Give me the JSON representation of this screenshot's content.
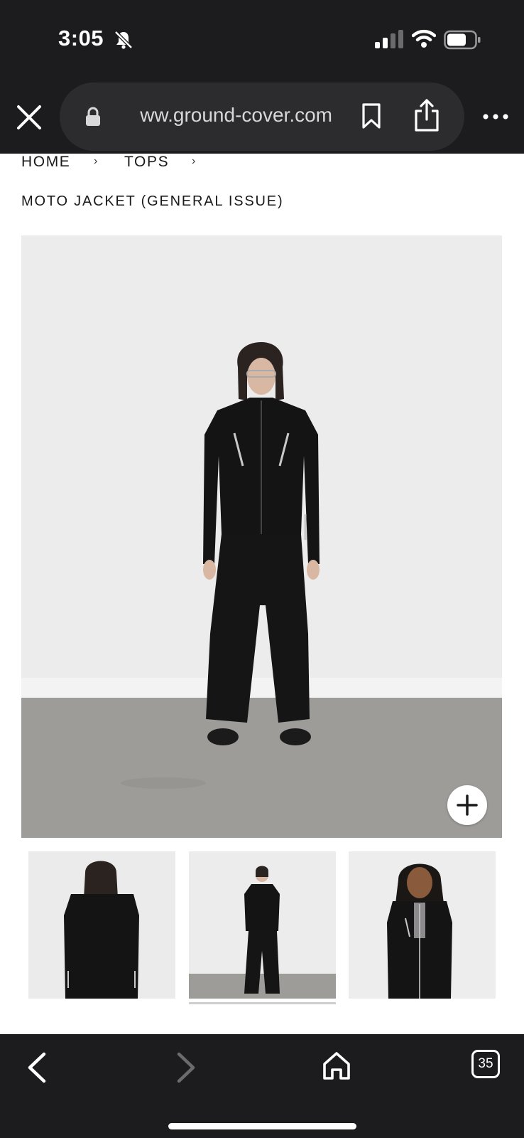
{
  "status_bar": {
    "time": "3:05"
  },
  "browser": {
    "url": "ww.ground-cover.com",
    "tab_count": "35"
  },
  "breadcrumb": {
    "items": [
      "HOME",
      "TOPS"
    ],
    "separator": "›"
  },
  "product": {
    "title": "MOTO JACKET (GENERAL ISSUE)"
  },
  "gallery": {
    "thumbnail_count": 3,
    "selected_thumbnail": 2
  },
  "icons": {
    "bell": "bell-slash-icon",
    "signal": "cellular-signal-icon",
    "wifi": "wifi-icon",
    "battery": "battery-icon",
    "close": "close-icon",
    "lock": "lock-icon",
    "bookmark": "bookmark-icon",
    "share": "share-icon",
    "more": "more-icon",
    "zoom": "plus-icon",
    "back": "chevron-left-icon",
    "forward": "chevron-right-icon",
    "home": "home-icon",
    "tabs": "tabs-icon"
  },
  "colors": {
    "chrome_bg": "#1c1c1e",
    "url_bar_bg": "#2c2c2e",
    "text": "#1a1a1a",
    "photo_wall": "#ececec",
    "photo_floor": "#9d9c99"
  }
}
